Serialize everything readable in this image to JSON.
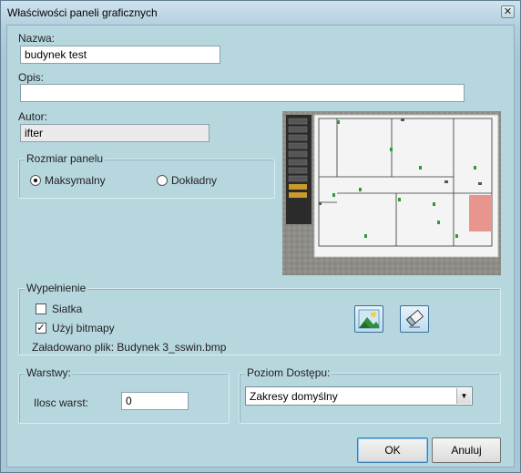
{
  "window": {
    "title": "Właściwości paneli graficznych",
    "close_glyph": "✕"
  },
  "form": {
    "name_label": "Nazwa:",
    "name_value": "budynek test",
    "desc_label": "Opis:",
    "desc_value": "",
    "author_label": "Autor:",
    "author_value": "ifter"
  },
  "panel_size": {
    "title": "Rozmiar panelu",
    "options": [
      {
        "label": "Maksymalny",
        "selected": true
      },
      {
        "label": "Dokładny",
        "selected": false
      }
    ]
  },
  "fill": {
    "title": "Wypełnienie",
    "grid_label": "Siatka",
    "grid_checked": false,
    "bitmap_label": "Użyj bitmapy",
    "bitmap_checked": true,
    "loaded_file": "Załadowano plik: Budynek 3_sswin.bmp",
    "load_image_icon": "landscape-image-icon",
    "clear_image_icon": "eraser-icon"
  },
  "layers": {
    "title": "Warstwy:",
    "count_label": "Ilosc warst:",
    "count_value": "0"
  },
  "access": {
    "title": "Poziom Dostępu:",
    "selected": "Zakresy domyślny"
  },
  "buttons": {
    "ok": "OK",
    "cancel": "Anuluj"
  },
  "colors": {
    "highlight_room": "#e8958e",
    "marker": "#2e9a3a",
    "accent_border": "#3c7fb1"
  }
}
